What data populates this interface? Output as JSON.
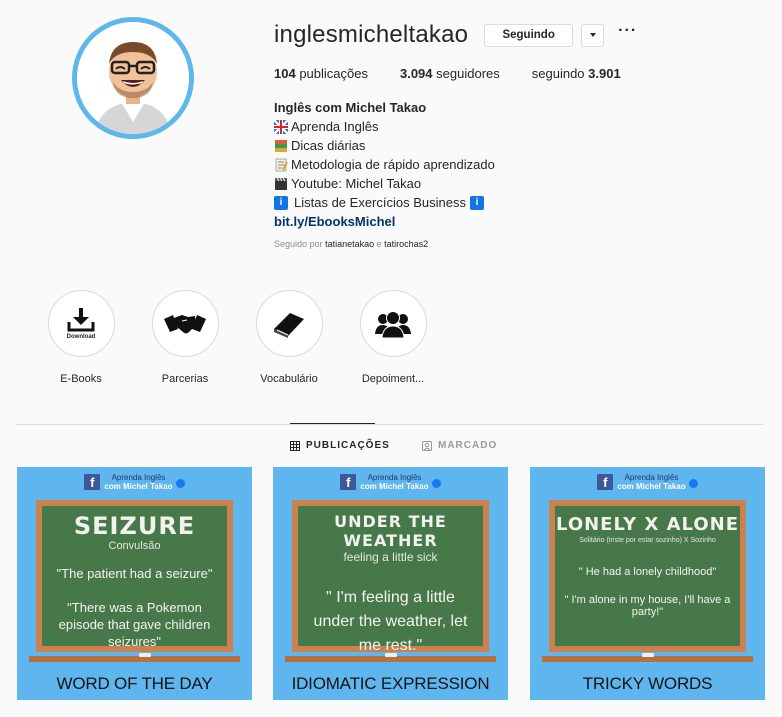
{
  "profile": {
    "username": "inglesmicheltakao",
    "follow_button": "Seguindo",
    "more_label": "···",
    "stats": {
      "posts_count": "104",
      "posts_label": "publicações",
      "followers_count": "3.094",
      "followers_label": "seguidores",
      "following_label": "seguindo",
      "following_count": "3.901"
    },
    "bio": {
      "name": "Inglês com Michel Takao",
      "lines": [
        {
          "icon": "english-flag-icon",
          "text": "Aprenda Inglês"
        },
        {
          "icon": "books-icon",
          "text": "Dicas diárias"
        },
        {
          "icon": "memo-icon",
          "text": "Metodologia de rápido aprendizado"
        },
        {
          "icon": "clapper-icon",
          "text": "Youtube: Michel Takao"
        },
        {
          "icon": "info-icon",
          "text": "Listas de Exercícios Business"
        }
      ],
      "link": "bit.ly/EbooksMichel"
    },
    "followed_by": {
      "prefix": "Seguido por",
      "user1": "tatianetakao",
      "conjunction": "e",
      "user2": "tatirochas2"
    }
  },
  "highlights": [
    {
      "label": "E-Books",
      "icon": "download-icon",
      "icon_text": "Download"
    },
    {
      "label": "Parcerias",
      "icon": "handshake-icon"
    },
    {
      "label": "Vocabulário",
      "icon": "book-icon"
    },
    {
      "label": "Depoiment...",
      "icon": "group-icon"
    }
  ],
  "tabs": {
    "posts": "PUBLICAÇÕES",
    "tagged": "MARCADO"
  },
  "posts": [
    {
      "brand_line1": "Aprenda Inglês",
      "brand_line2": "com Michel Takao",
      "title": "SEIZURE",
      "subtitle": "Convulsão",
      "quote1": "\"The patient had a seizure\"",
      "quote2": "\"There was a Pokemon episode that gave children seizures\"",
      "footer": "WORD OF THE DAY"
    },
    {
      "brand_line1": "Aprenda Inglês",
      "brand_line2": "com Michel Takao",
      "title": "UNDER THE WEATHER",
      "subtitle": "feeling a little sick",
      "quote1": "\" I'm feeling a little under the weather, let me rest.\"",
      "footer": "IDIOMATIC EXPRESSION"
    },
    {
      "brand_line1": "Aprenda Inglês",
      "brand_line2": "com Michel Takao",
      "title": "LONELY X ALONE",
      "subtitle": "Solitário (triste por estar sozinho) X Sozinho",
      "quote1": "\" He had a lonely childhood\"",
      "quote2": "\" I'm alone in my house, I'll have a party!\"",
      "footer": "TRICKY WORDS"
    }
  ],
  "colors": {
    "avatar_ring": "#5db7ea",
    "post_background": "#5fb6ee",
    "chalkboard": "#47784a",
    "board_frame": "#c9824f",
    "link": "#003569"
  }
}
